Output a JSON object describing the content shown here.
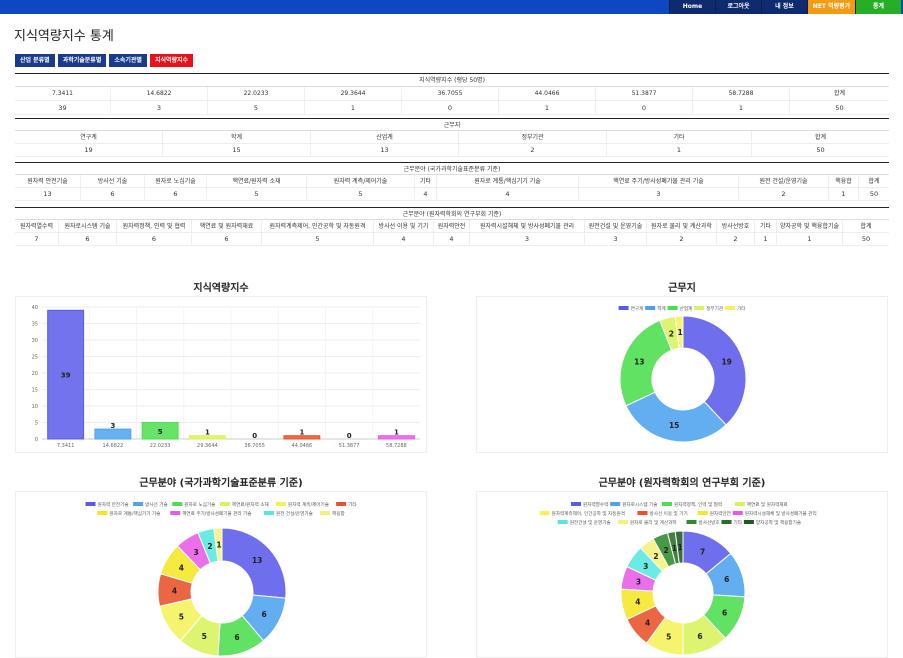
{
  "nav": [
    {
      "label": "Home",
      "color": "#0d2b6e"
    },
    {
      "label": "로그아웃",
      "color": "#0d2b6e"
    },
    {
      "label": "내 정보",
      "color": "#0d2b6e"
    },
    {
      "label": "NET 역량평가",
      "color": "#f39c12"
    },
    {
      "label": "통계",
      "color": "#27ae27"
    }
  ],
  "page_title": "지식역량지수 통계",
  "tabs": [
    {
      "label": "산업 분류별",
      "active": false
    },
    {
      "label": "과학기술분류별",
      "active": false
    },
    {
      "label": "소속기관별",
      "active": false
    },
    {
      "label": "지식역량지수",
      "active": true
    }
  ],
  "sections": {
    "knowledge": {
      "title": "지식역량지수 (랭당 50명)",
      "headers": [
        "7.3411",
        "14.6822",
        "22.0233",
        "29.3644",
        "36.7055",
        "44.0466",
        "51.3877",
        "58.7288",
        "합계"
      ],
      "values": [
        "39",
        "3",
        "5",
        "1",
        "0",
        "1",
        "0",
        "1",
        "50"
      ]
    },
    "workplace": {
      "title": "근무지",
      "headers": [
        "연구계",
        "학계",
        "산업계",
        "정부기관",
        "기타",
        "합계"
      ],
      "values": [
        "19",
        "15",
        "13",
        "2",
        "1",
        "50"
      ]
    },
    "field_std": {
      "title": "근무분야 (국가과학기술표준분류 기준)",
      "headers": [
        "원자력 안전기술",
        "방사선 기술",
        "원자로 노심기술",
        "핵연료/원자력 소재",
        "원자력 계측/제어기술",
        "기타",
        "원자로 계통/핵심기기 기술",
        "핵연료 주기/방사성폐기물 관리 기술",
        "원전 건설/운영기술",
        "핵융합",
        "합계"
      ],
      "values": [
        "13",
        "6",
        "6",
        "5",
        "5",
        "4",
        "4",
        "3",
        "2",
        "1",
        "50"
      ]
    },
    "field_society": {
      "title": "근무분야 (원자력학회의 연구부회 기준)",
      "headers": [
        "원자력열수력",
        "원자로시스템 기술",
        "원자력정책, 인력 및 협력",
        "핵연료 및 원자력재료",
        "원자력계측제어, 인간공학 및 자동원격",
        "방사선 이용 및 기기",
        "원자력안전",
        "원자력시설해체 및 방사성폐기물 관리",
        "원전건설 및 운영기술",
        "원자로 물리 및 계산과학",
        "방사선방호",
        "기타",
        "양자공학 및 핵융합기술",
        "합계"
      ],
      "values": [
        "7",
        "6",
        "6",
        "6",
        "5",
        "4",
        "4",
        "3",
        "3",
        "2",
        "2",
        "1",
        "1",
        "50"
      ]
    }
  },
  "chart_data": [
    {
      "type": "bar",
      "title": "지식역량지수",
      "categories": [
        "7.3411",
        "14.6822",
        "22.0233",
        "29.3644",
        "36.7055",
        "44.0466",
        "51.3877",
        "58.7288"
      ],
      "values": [
        39,
        3,
        5,
        1,
        0,
        1,
        0,
        1
      ],
      "colors": [
        "#5b5bea",
        "#4da3ee",
        "#4cde4c",
        "#d8f25c",
        "#f5f15a",
        "#e8522a",
        "#e85be8",
        "#e85be8"
      ],
      "ylim": [
        0,
        40
      ],
      "yticks": [
        0,
        5,
        10,
        15,
        20,
        25,
        30,
        35,
        40
      ],
      "grid": true
    },
    {
      "type": "pie",
      "title": "근무지",
      "legend": [
        "연구계",
        "학계",
        "산업계",
        "정부기관",
        "기타"
      ],
      "values": [
        19,
        15,
        13,
        2,
        1
      ],
      "colors": [
        "#5b5bea",
        "#4da3ee",
        "#4cde4c",
        "#d8f25c",
        "#f5f15a"
      ],
      "legend_position": "top"
    },
    {
      "type": "pie",
      "title": "근무분야 (국가과학기술표준분류 기준)",
      "legend": [
        "원자력 안전기술",
        "방사선 기술",
        "원자로 노심기술",
        "핵연료/원자력 소재",
        "원자력 계측/제어기술",
        "기타",
        "원자로 계통/핵심기기 기술",
        "핵연료 주기/방사성폐기물 관리 기술",
        "원전 건설/운영기술",
        "핵융합"
      ],
      "values": [
        13,
        6,
        6,
        5,
        5,
        4,
        4,
        3,
        2,
        1
      ],
      "colors": [
        "#5b5bea",
        "#4da3ee",
        "#4cde4c",
        "#d8f25c",
        "#f5f15a",
        "#e8522a",
        "#f5e626",
        "#e85be8",
        "#55e8e0",
        "#f2f27a"
      ],
      "legend_position": "top"
    },
    {
      "type": "pie",
      "title": "근무분야 (원자력학회의 연구부회 기준)",
      "legend": [
        "원자력열수력",
        "원자로시스템 기술",
        "원자력정책, 인력 및 협력",
        "핵연료 및 원자력재료",
        "원자력계측제어, 인간공학 및 자동원격",
        "방사선 이용 및 기기",
        "원자력안전",
        "원자력시설해체 및 방사성폐기물 관리",
        "원전건설 및 운영기술",
        "원자로 물리 및 계산과학",
        "방사선방호",
        "기타",
        "양자공학 및 핵융합기술"
      ],
      "values": [
        7,
        6,
        6,
        6,
        5,
        4,
        4,
        3,
        3,
        2,
        2,
        1,
        1
      ],
      "colors": [
        "#5b5bea",
        "#4da3ee",
        "#4cde4c",
        "#d8f25c",
        "#f5f15a",
        "#e8522a",
        "#f5e626",
        "#e85be8",
        "#55e8e0",
        "#f2f27a",
        "#2e8b2e",
        "#2a6e2a",
        "#1e5a1e"
      ],
      "legend_position": "top"
    }
  ]
}
